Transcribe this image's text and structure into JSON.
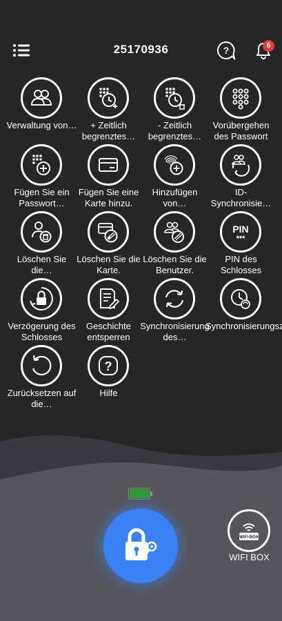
{
  "header": {
    "title": "25170936",
    "menu_icon": "hamburger-menu-icon",
    "help_icon": "help-chat-icon",
    "bell_icon": "bell-icon",
    "notification_count": "6"
  },
  "tiles": [
    {
      "label": "Verwaltung von…",
      "icon": "users-icon"
    },
    {
      "label": "+ Zeitlich begrenztes…",
      "icon": "keypad-clock-add-icon"
    },
    {
      "label": "- Zeitlich begrenztes…",
      "icon": "keypad-clock-delete-icon"
    },
    {
      "label": "Vorübergehen des Passwort",
      "icon": "keypad-icon"
    },
    {
      "label": "Fügen Sie ein Passwort…",
      "icon": "keypad-add-icon"
    },
    {
      "label": "Fügen Sie eine Karte hinzu.",
      "icon": "card-icon"
    },
    {
      "label": "Hinzufügen von…",
      "icon": "fingerprint-add-icon"
    },
    {
      "label": "ID-Synchronisie…",
      "icon": "users-sync-icon"
    },
    {
      "label": "Löschen Sie die…",
      "icon": "user-delete-icon"
    },
    {
      "label": "Löschen Sie die Karte.",
      "icon": "card-delete-icon"
    },
    {
      "label": "Löschen Sie die Benutzer.",
      "icon": "users-delete-icon"
    },
    {
      "label": "PIN des Schlosses",
      "icon": "pin-icon"
    },
    {
      "label": "Verzögerung des Schlosses",
      "icon": "lock-delay-icon"
    },
    {
      "label": "Geschichte entsperren",
      "icon": "history-icon"
    },
    {
      "label": "Synchronisierung des…",
      "icon": "sync-icon"
    },
    {
      "label": "Synchronisierungszeit",
      "icon": "sync-time-icon"
    },
    {
      "label": "Zurücksetzen auf die…",
      "icon": "reset-icon"
    },
    {
      "label": "Hilfe",
      "icon": "help-icon"
    }
  ],
  "bottom": {
    "battery_icon": "battery-full-icon",
    "battery_color": "#2e9e3a",
    "lock_icon": "lock-key-icon",
    "lock_color": "#3b82f6",
    "wifi_box_icon": "wifi-box-icon",
    "wifi_box_icon_text": "WIFI-BOX",
    "wifi_box_label": "WIFI BOX"
  }
}
